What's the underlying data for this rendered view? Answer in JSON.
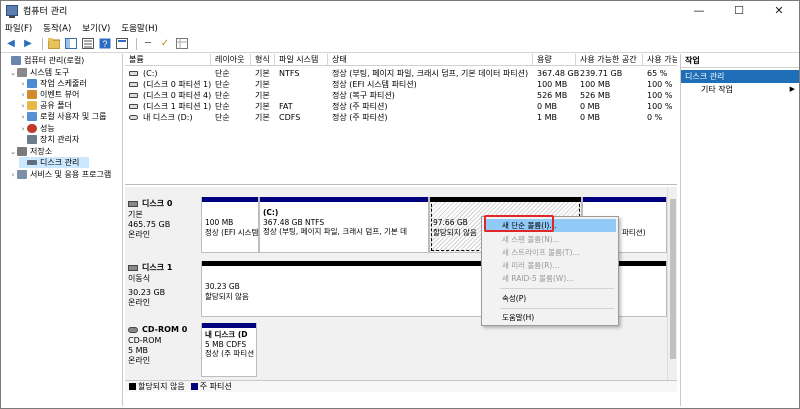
{
  "title": "컴퓨터 관리",
  "window_controls": {
    "minimize": "—",
    "maximize": "☐",
    "close": "✕"
  },
  "menu": [
    "파일(F)",
    "동작(A)",
    "보기(V)",
    "도움말(H)"
  ],
  "tree": [
    {
      "label": "컴퓨터 관리(로컬)",
      "level": 0,
      "toggle": "",
      "color": "#6a86b0"
    },
    {
      "label": "시스템 도구",
      "level": 1,
      "toggle": "⌄",
      "color": "#8a8a8a"
    },
    {
      "label": "작업 스케줄러",
      "level": 2,
      "toggle": "›",
      "color": "#4b8bd1"
    },
    {
      "label": "이벤트 뷰어",
      "level": 2,
      "toggle": "›",
      "color": "#d08b2d"
    },
    {
      "label": "공유 폴더",
      "level": 2,
      "toggle": "›",
      "color": "#e6b84a"
    },
    {
      "label": "로컬 사용자 및 그룹",
      "level": 2,
      "toggle": "›",
      "color": "#5a8ed0"
    },
    {
      "label": "성능",
      "level": 2,
      "toggle": "›",
      "color": "#c0392b"
    },
    {
      "label": "장치 관리자",
      "level": 2,
      "toggle": "",
      "color": "#6b7b8c"
    },
    {
      "label": "저장소",
      "level": 1,
      "toggle": "⌄",
      "color": "#7a7a7a"
    },
    {
      "label": "디스크 관리",
      "level": 2,
      "toggle": "",
      "color": "#5f6f80",
      "selected": true
    },
    {
      "label": "서비스 및 응용 프로그램",
      "level": 1,
      "toggle": "›",
      "color": "#7b8fa6"
    }
  ],
  "volume_columns": [
    "볼륨",
    "레이아웃",
    "형식",
    "파일 시스템",
    "상태",
    "용량",
    "사용 가능한 공간",
    "사용 가능"
  ],
  "volumes": [
    [
      "(C:)",
      "단순",
      "기본",
      "NTFS",
      "정상 (부팅, 페이지 파일, 크래시 덤프, 기본 데이터 파티션)",
      "367.48 GB",
      "239.71 GB",
      "65 %"
    ],
    [
      "(디스크 0 파티션 1)",
      "단순",
      "기본",
      "",
      "정상 (EFI 시스템 파티션)",
      "100 MB",
      "100 MB",
      "100 %"
    ],
    [
      "(디스크 0 파티션 4)",
      "단순",
      "기본",
      "",
      "정상 (복구 파티션)",
      "526 MB",
      "526 MB",
      "100 %"
    ],
    [
      "(디스크 1 파티션 1)",
      "단순",
      "기본",
      "FAT",
      "정상 (주 파티션)",
      "0 MB",
      "0 MB",
      "100 %"
    ],
    [
      "내 디스크 (D:)",
      "단순",
      "기본",
      "CDFS",
      "정상 (주 파티션)",
      "1 MB",
      "0 MB",
      "0 %"
    ]
  ],
  "disks": [
    {
      "name": "디스크 0",
      "type": "기본",
      "size": "465.75 GB",
      "state": "온라인"
    },
    {
      "name": "디스크 1",
      "type": "이동식",
      "size": "30.23 GB",
      "state": "온라인"
    },
    {
      "name": "CD-ROM 0",
      "type": "CD-ROM",
      "size": "5 MB",
      "state": "온라인"
    }
  ],
  "partitions": {
    "d0p1": {
      "line1": "100 MB",
      "line2": "정상 (EFI 시스템"
    },
    "d0p2": {
      "title": "(C:)",
      "line1": "367.48 GB NTFS",
      "line2": "정상 (부팅, 페이지 파일, 크래시 덤프, 기본 데"
    },
    "d0p3": {
      "line1": "97.66 GB",
      "line2": "할당되지 않음"
    },
    "d0p4": {
      "line2": "파티션)"
    },
    "d1p1": {
      "line1": "30.23 GB",
      "line2": "할당되지 않음"
    },
    "cdp1": {
      "title": "내 디스크  (D",
      "line1": "5 MB CDFS",
      "line2": "정상 (주 파티션"
    }
  },
  "legend": {
    "unallocated": "할당되지 않음",
    "primary": "주 파티션"
  },
  "actions": {
    "header": "작업",
    "selected": "디스크 관리",
    "more": "기타 작업"
  },
  "context_menu": [
    {
      "label": "새 단순 볼륨(I)...",
      "state": "highlighted"
    },
    {
      "label": "새 스팬 볼륨(N)...",
      "state": "disabled"
    },
    {
      "label": "새 스트라이프 볼륨(T)...",
      "state": "disabled"
    },
    {
      "label": "새 미러 볼륨(R)...",
      "state": "disabled"
    },
    {
      "label": "새 RAID-5 볼륨(W)...",
      "state": "disabled"
    },
    {
      "label": "속성(P)",
      "state": "normal"
    },
    {
      "label": "도움말(H)",
      "state": "normal"
    }
  ],
  "colors": {
    "partition_bar": "#00007f",
    "unallocated_bar": "#000000",
    "menu_highlight": "#91c9f7",
    "callout": "#e0262b"
  }
}
